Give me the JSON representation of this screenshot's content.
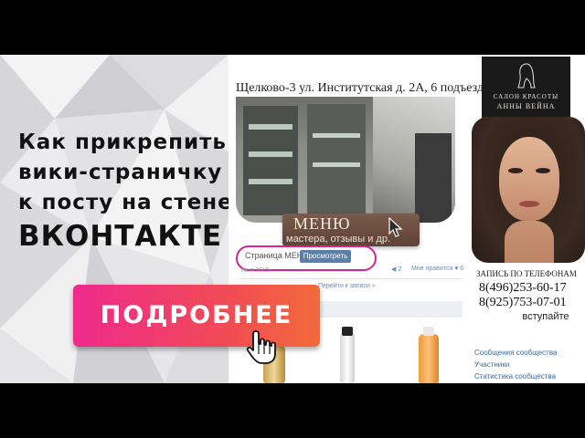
{
  "headline": {
    "line1": "Как прикрепить",
    "line2": "вики-страничку",
    "line3": "к посту на стене",
    "line4": "ВКОНТАКТЕ"
  },
  "cta": {
    "label": "ПОДРОБНЕЕ"
  },
  "post": {
    "address": "Щелково-3 ул. Институтская д. 2А, 6 подъезд",
    "menu_title": "МЕНЮ",
    "menu_subtitle": "мастера, отзывы и др.",
    "wiki_label": "Страница МЕНЮ",
    "view_button": "Просмотреть",
    "date": "июл 2015",
    "repost_count": "2",
    "likes_label": "Мне нравится",
    "likes_count": "6",
    "goto_link": "Перейти к записи »"
  },
  "salon": {
    "logo_line1": "САЛОН КРАСОТЫ",
    "logo_line2": "АННЫ ВЕЙНА",
    "phone_label": "ЗАПИСЬ ПО ТЕЛЕФОНАМ",
    "phone1": "8(496)253-60-17",
    "phone2": "8(925)753-07-01",
    "join_button": "вступайте"
  },
  "sidebar_links": [
    "Сообщения сообщества",
    "Участники",
    "Статистика сообщества"
  ],
  "colors": {
    "cta_start": "#ef2a8d",
    "cta_end": "#f26a3a",
    "wiki_border": "#d0249b",
    "vk_link": "#3c6aa0",
    "vk_button": "#5b7fa6"
  }
}
